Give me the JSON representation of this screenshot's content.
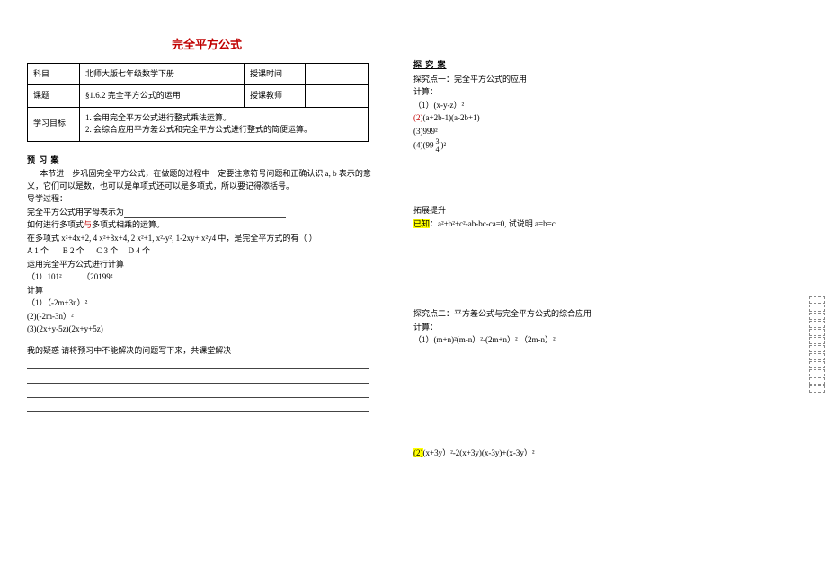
{
  "title": "完全平方公式",
  "meta": {
    "r1c1": "科目",
    "r1c2": "北师大版七年级数学下册",
    "r1c3": "授课时间",
    "r1c4": "",
    "r2c1": "课题",
    "r2c2": "§1.6.2 完全平方公式的运用",
    "r2c3": "授课教师",
    "r2c4": "",
    "r3c1": "学习目标",
    "r3c2": "1. 会用完全平方公式进行整式乘法运算。\n2. 会综合应用平方差公式和完全平方公式进行整式的简便运算。"
  },
  "preview": {
    "head": "预  习    案",
    "intro": "本节进一步巩固完全平方公式，在做题的过程中一定要注意符号问题和正确认识 a, b 表示的意义，它们可以是数，也可以是单项式还可以是多项式，所以要记得添括号。",
    "guide": "导学过程：",
    "line1": "完全平方公式用字母表示为",
    "line2_pre": "如何进行多项式",
    "line2_red": "与",
    "line2_post": "多项式相乘的运算。",
    "poly_q": "在多项式 x²+4x+2, 4 x²+8x+4, 2 x²+1, x²-y², 1-2xy+ x²y4 中，是完全平方式的有（  ）",
    "optA": "A 1 个",
    "optB": "B 2 个",
    "optC": "C 3 个",
    "optD": "D 4 个",
    "calc_title": "运用完全平方公式进行计算",
    "calc1": "（1）101²          （20199²",
    "calc_h": "计算",
    "c1": "（1）（-2m+3n）²",
    "c2": "(2)(-2m-3n）²",
    "c3": "(3)(2x+y-5z)(2x+y+5z)",
    "doubt": "我的疑惑  请将预习中不能解决的问题写下来，共课堂解决"
  },
  "explore": {
    "head": "探  究    案",
    "p1_title": "探究点一：完全平方公式的应用",
    "calc": "计算：",
    "e1": "（1）(x-y-z）²",
    "e2_red": "(2)",
    "e2": "(a+2b-1)(a-2b+1)",
    "e3": "(3)999²",
    "e4_pre": "(4)(99",
    "e4_post": ")²",
    "frac_n": "3",
    "frac_d": "4",
    "ext_title": "拓展提升",
    "ext_yel": "已知",
    "ext_body": "：a²+b²+c²-ab-bc-ca=0, 试说明 a=b=c",
    "p2_title": "探究点二：平方差公式与完全平方公式的综合应用",
    "p2_calc": "计算：",
    "p2_1": "（1）(m+n)²(m-n）²-(2m+n）² （2m-n）²",
    "p2_2_red": "(2)",
    "p2_2": "(x+3y）²-2(x+3y)(x-3y)+(x-3y）²"
  }
}
